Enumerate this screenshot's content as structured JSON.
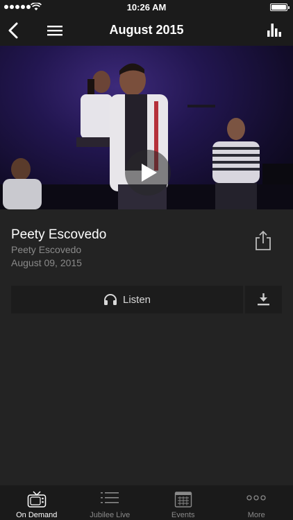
{
  "status": {
    "time": "10:26 AM"
  },
  "nav": {
    "title": "August 2015"
  },
  "media": {
    "title": "Peety Escovedo",
    "speaker": "Peety Escovedo",
    "date": "August 09, 2015",
    "listen_label": "Listen"
  },
  "tabs": [
    {
      "label": "On Demand",
      "icon": "tv-icon",
      "active": true
    },
    {
      "label": "Jubilee Live",
      "icon": "list-icon",
      "active": false
    },
    {
      "label": "Events",
      "icon": "calendar-icon",
      "active": false
    },
    {
      "label": "More",
      "icon": "more-dots-icon",
      "active": false
    }
  ],
  "colors": {
    "background": "#232323",
    "bar": "#1b1b1b",
    "muted_text": "#8a8a8a"
  }
}
